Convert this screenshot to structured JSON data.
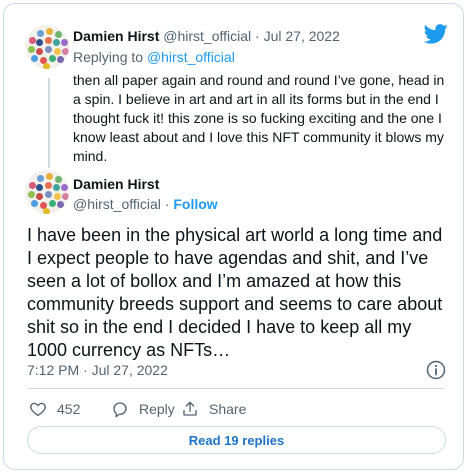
{
  "reply_tweet": {
    "author_name": "Damien Hirst",
    "author_handle": "@hirst_official",
    "separator": "·",
    "date": "Jul 27, 2022",
    "replying_prefix": "Replying to",
    "replying_handle": "@hirst_official",
    "text": "then all paper again and round and round I’ve gone, head in a spin. I believe in art and art in all its forms but in the end I thought fuck it! this zone is so fucking exciting and the one I know least about and I love this NFT community it blows my mind."
  },
  "main_tweet": {
    "author_name": "Damien Hirst",
    "author_handle": "@hirst_official",
    "separator": "·",
    "follow_label": "Follow",
    "text": "I have been in the physical art world a long time and I expect people to have agendas and shit, and I’ve seen a lot of bollox and I’m amazed at how this community breeds support and seems to care about shit so in the end I decided I have to keep all my 1000 currency as NFTs…",
    "timestamp": "7:12 PM · Jul 27, 2022",
    "like_count": "452",
    "reply_label": "Reply",
    "share_label": "Share",
    "read_replies_label": "Read 19 replies"
  },
  "icons": {
    "logo": "twitter-bird-icon",
    "info": "info-icon",
    "like": "heart-icon",
    "reply": "reply-bubble-icon",
    "share": "share-icon"
  },
  "colors": {
    "accent": "#1d9bf0",
    "muted": "#536471",
    "border": "#cfd9de"
  }
}
